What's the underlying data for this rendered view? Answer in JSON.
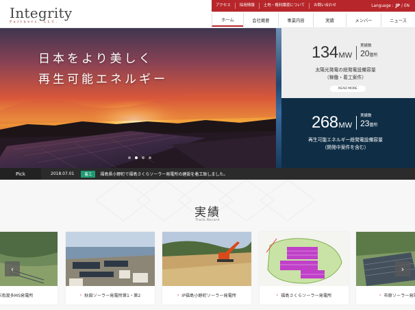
{
  "logo": {
    "word": "Integrity",
    "sub": "Partners, LLC."
  },
  "topbar": {
    "links": [
      "アクセス",
      "採用情報",
      "土地・権利譲渡について",
      "お問い合わせ"
    ],
    "language_label": "Language :",
    "lang_jp": "JP",
    "lang_sep": "/",
    "lang_en": "EN"
  },
  "nav": {
    "items": [
      "ホーム",
      "会社概要",
      "事業内容",
      "実績",
      "メンバー",
      "ニュース"
    ],
    "active": "ホーム"
  },
  "hero": {
    "line1": "日本をより美しく",
    "line2": "再生可能エネルギー",
    "slide_count": 4,
    "active_slide": 2
  },
  "stats": [
    {
      "value": "134",
      "unit": "MW",
      "count_label": "実績数",
      "count_value": "20",
      "count_unit": "箇所",
      "desc1": "太陽光発電の総発電設備容量",
      "desc2": "（稼働・着工案件）",
      "button": "READ MORE"
    },
    {
      "value": "268",
      "unit": "MW",
      "count_label": "実績数",
      "count_value": "23",
      "count_unit": "箇所",
      "desc1": "再生可能エネルギー総発電設備容量",
      "desc2": "（開発中案件を含む）"
    }
  ],
  "pick": {
    "label": "Pick",
    "date": "2018.07.01",
    "badge": "着工",
    "text": "福島県小野町で福島さくらソーラー発電所の建設を着工致しました。"
  },
  "track": {
    "title": "実績",
    "subtitle": "Track Record",
    "cards": [
      {
        "label": "市南渡多MS発電所"
      },
      {
        "label": "秋田ソーラー発電所第1・第2"
      },
      {
        "label": "IP福島小野町ソーラー発電所"
      },
      {
        "label": "福島さくらソーラー発電所"
      },
      {
        "label": "市原ソーラー発電所"
      }
    ],
    "prev": "‹",
    "next": "›",
    "arrow": "›"
  },
  "colors": {
    "accent": "#b7262a",
    "navy": "#0f2e46",
    "badge": "#1f9a72"
  }
}
